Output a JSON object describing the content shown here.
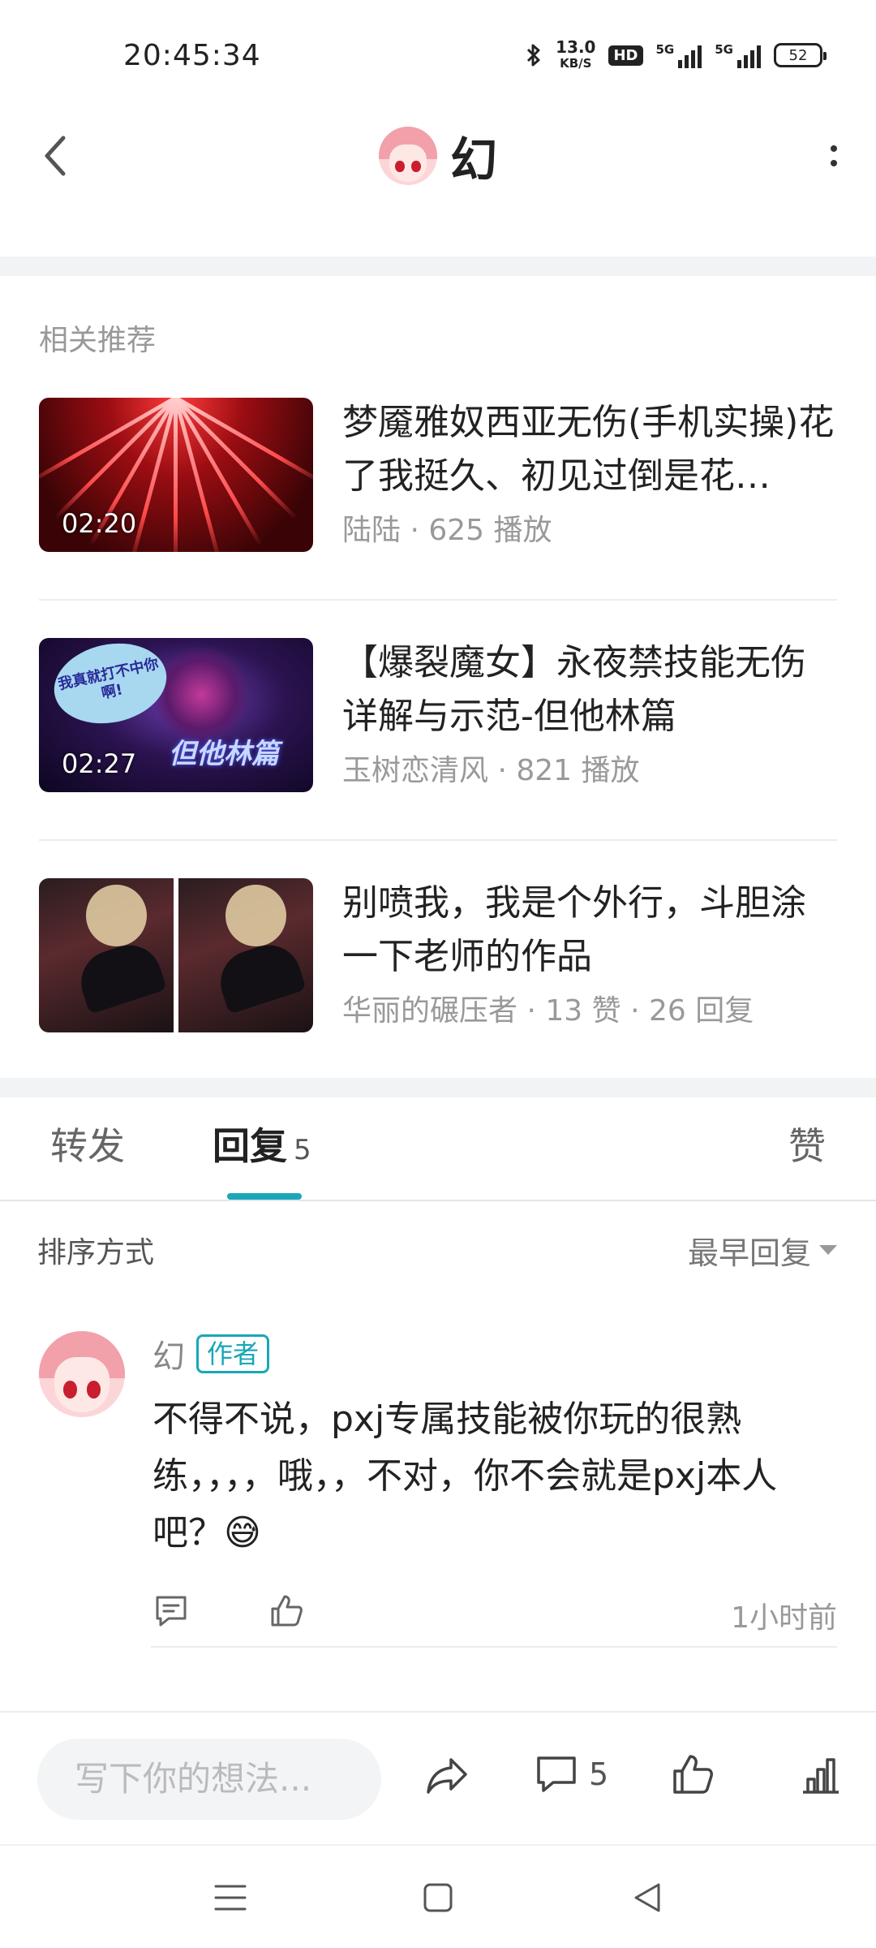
{
  "status_bar": {
    "time": "20:45:34",
    "net_speed_value": "13.0",
    "net_speed_unit": "KB/S",
    "hd_badge": "HD",
    "signal1_label": "5G",
    "signal2_label": "5G",
    "battery": "52"
  },
  "header": {
    "title": "幻"
  },
  "related": {
    "section_title": "相关推荐",
    "items": [
      {
        "title": "梦魇雅奴西亚无伤(手机实操)花了我挺久、初见过倒是花…",
        "duration": "02:20",
        "author": "陆陆",
        "stat": "625 播放"
      },
      {
        "title": "【爆裂魔女】永夜禁技能无伤详解与示范-但他林篇",
        "duration": "02:27",
        "author": "玉树恋清风",
        "stat": "821 播放",
        "thumb_bubble": "我真就打不中你啊!",
        "thumb_caption": "但他林篇"
      },
      {
        "title": "别喷我，我是个外行，斗胆涂一下老师的作品",
        "author": "华丽的碾压者",
        "stat": "13 赞",
        "stat2": "26 回复"
      }
    ]
  },
  "tabs": {
    "forward": "转发",
    "reply": "回复",
    "reply_count": "5",
    "like": "赞"
  },
  "sort": {
    "label": "排序方式",
    "value": "最早回复"
  },
  "comment": {
    "author": "幻",
    "badge": "作者",
    "text": "不得不说，pxj专属技能被你玩的很熟练，，，，哦，，不对，你不会就是pxj本人吧？😅",
    "time": "1小时前"
  },
  "bottom_bar": {
    "input_placeholder": "写下你的想法...",
    "comment_count": "5"
  },
  "colors": {
    "accent": "#19a7b8",
    "text_primary": "#222222",
    "text_secondary": "#999999"
  }
}
